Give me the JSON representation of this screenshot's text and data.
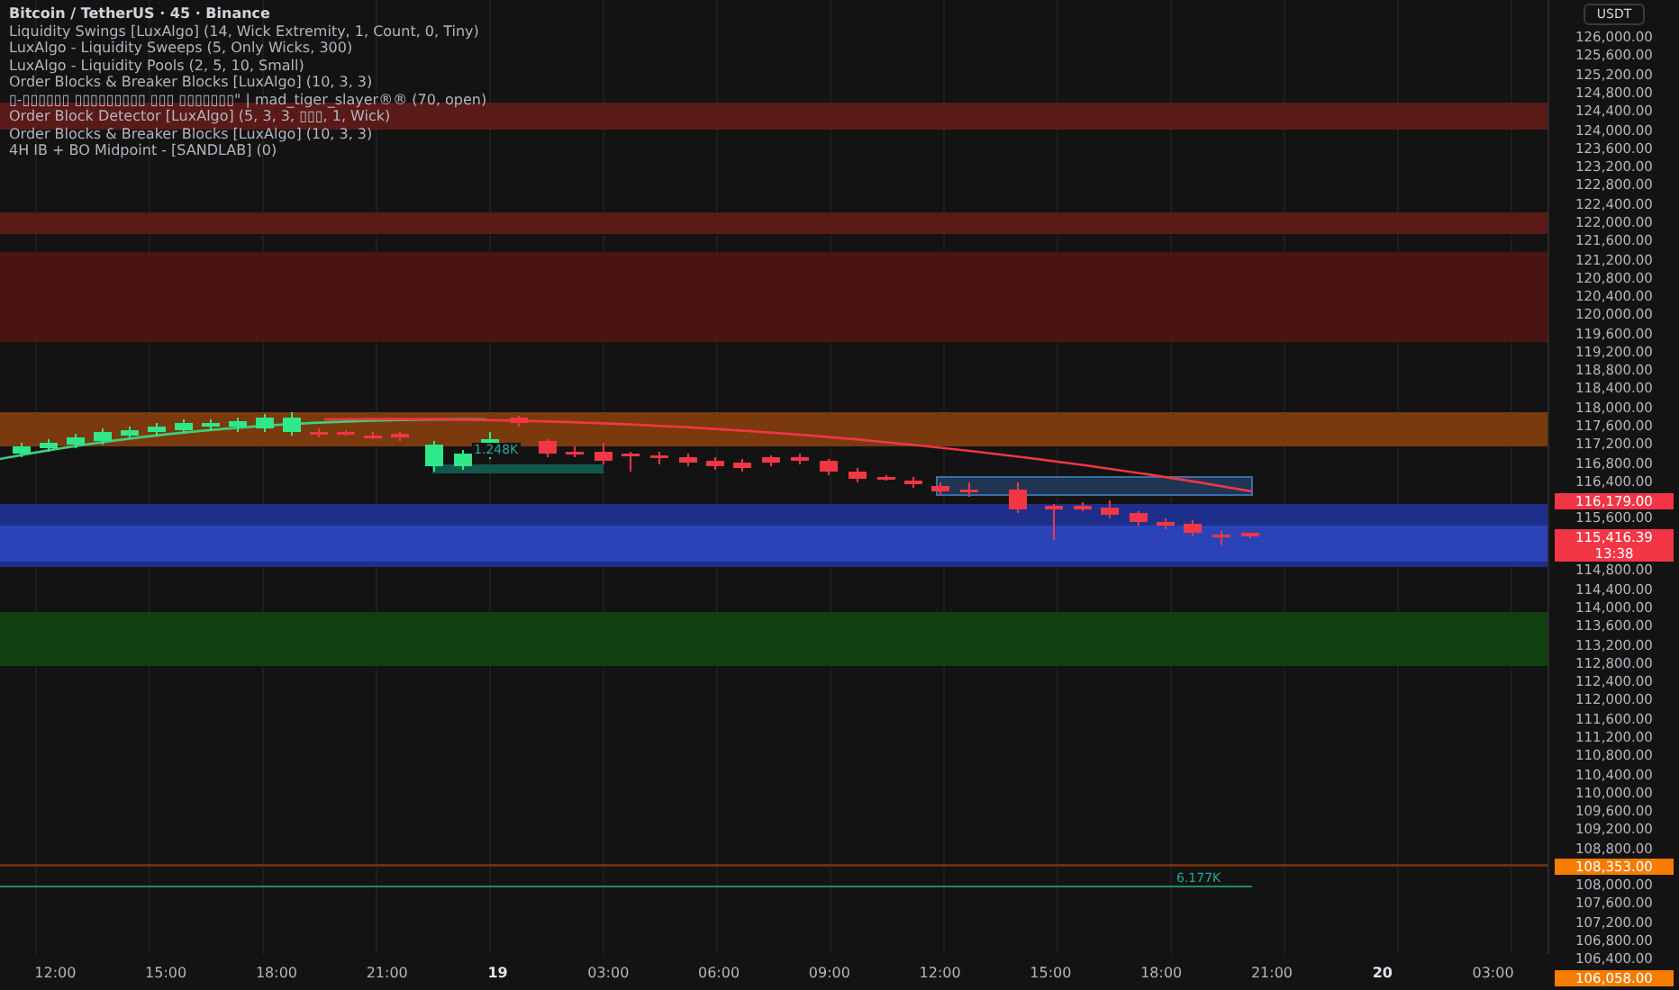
{
  "legend": {
    "title": "Bitcoin / TetherUS · 45 · Binance",
    "indicators": [
      "Liquidity Swings [LuxAlgo] (14, Wick Extremity, 1, Count, 0, Tiny)",
      "LuxAlgo - Liquidity Sweeps (5, Only Wicks, 300)",
      "LuxAlgo - Liquidity Pools (2, 5, 10, Small)",
      "Order Blocks & Breaker Blocks [LuxAlgo] (10, 3, 3)",
      "▯-▯▯▯▯▯▯ ▯▯▯▯▯▯▯▯▯ ▯▯▯ ▯▯▯▯▯▯▯\" | mad_tiger_slayer®® (70, open)",
      "Order Block Detector [LuxAlgo] (5, 3, 3, ▯▯▯, 1, Wick)",
      "Order Blocks & Breaker Blocks [LuxAlgo] (10, 3, 3)",
      "4H IB + BO Midpoint - [SANDLAB] (0)"
    ]
  },
  "chart_labels": [
    "1.248K",
    "6.177K"
  ],
  "price_axis": {
    "currency": "USDT",
    "labels": [
      {
        "kind": "tick",
        "text": "126,000.00"
      },
      {
        "kind": "tick",
        "text": "125,600.00"
      },
      {
        "kind": "tick",
        "text": "125,200.00"
      },
      {
        "kind": "tick",
        "text": "124,800.00"
      },
      {
        "kind": "tick",
        "text": "124,400.00"
      },
      {
        "kind": "tick",
        "text": "124,000.00"
      },
      {
        "kind": "tick",
        "text": "123,600.00"
      },
      {
        "kind": "tick",
        "text": "123,200.00"
      },
      {
        "kind": "tick",
        "text": "122,800.00"
      },
      {
        "kind": "tick",
        "text": "122,400.00"
      },
      {
        "kind": "tick",
        "text": "122,000.00"
      },
      {
        "kind": "tick",
        "text": "121,600.00"
      },
      {
        "kind": "tick",
        "text": "121,200.00"
      },
      {
        "kind": "tick",
        "text": "120,800.00"
      },
      {
        "kind": "tick",
        "text": "120,400.00"
      },
      {
        "kind": "tick",
        "text": "120,000.00"
      },
      {
        "kind": "tick",
        "text": "119,600.00"
      },
      {
        "kind": "tick",
        "text": "119,200.00"
      },
      {
        "kind": "tick",
        "text": "118,800.00"
      },
      {
        "kind": "tick",
        "text": "118,400.00"
      },
      {
        "kind": "tick",
        "text": "118,000.00"
      },
      {
        "kind": "tick",
        "text": "117,600.00"
      },
      {
        "kind": "tick",
        "text": "117,200.00"
      },
      {
        "kind": "tick",
        "text": "116,800.00"
      },
      {
        "kind": "tick",
        "text": "116,400.00"
      },
      {
        "kind": "tag",
        "text": "116,179.00",
        "color": "#f23645"
      },
      {
        "kind": "tick",
        "text": "115,600.00"
      },
      {
        "kind": "tag",
        "text": "115,416.39",
        "sub": "13:38",
        "color": "#f23645"
      },
      {
        "kind": "tick",
        "text": "114,800.00"
      },
      {
        "kind": "tick",
        "text": "114,400.00"
      },
      {
        "kind": "tick",
        "text": "114,000.00"
      },
      {
        "kind": "tick",
        "text": "113,600.00"
      },
      {
        "kind": "tick",
        "text": "113,200.00"
      },
      {
        "kind": "tick",
        "text": "112,800.00"
      },
      {
        "kind": "tick",
        "text": "112,400.00"
      },
      {
        "kind": "tick",
        "text": "112,000.00"
      },
      {
        "kind": "tick",
        "text": "111,600.00"
      },
      {
        "kind": "tick",
        "text": "111,200.00"
      },
      {
        "kind": "tick",
        "text": "110,800.00"
      },
      {
        "kind": "tick",
        "text": "110,400.00"
      },
      {
        "kind": "tick",
        "text": "110,000.00"
      },
      {
        "kind": "tick",
        "text": "109,600.00"
      },
      {
        "kind": "tick",
        "text": "109,200.00"
      },
      {
        "kind": "tick",
        "text": "108,800.00"
      },
      {
        "kind": "tag",
        "text": "108,353.00",
        "color": "#f57c00"
      },
      {
        "kind": "tick",
        "text": "108,000.00"
      },
      {
        "kind": "tick",
        "text": "107,600.00"
      },
      {
        "kind": "tick",
        "text": "107,200.00"
      },
      {
        "kind": "tick",
        "text": "106,800.00"
      },
      {
        "kind": "tick",
        "text": "106,400.00"
      },
      {
        "kind": "tag",
        "text": "106,058.00",
        "color": "#f57c00"
      }
    ]
  },
  "time_axis": [
    {
      "kind": "time",
      "text": "12:00"
    },
    {
      "kind": "time",
      "text": "15:00"
    },
    {
      "kind": "time",
      "text": "18:00"
    },
    {
      "kind": "time",
      "text": "21:00"
    },
    {
      "kind": "day",
      "text": "19"
    },
    {
      "kind": "time",
      "text": "03:00"
    },
    {
      "kind": "time",
      "text": "06:00"
    },
    {
      "kind": "time",
      "text": "09:00"
    },
    {
      "kind": "time",
      "text": "12:00"
    },
    {
      "kind": "time",
      "text": "15:00"
    },
    {
      "kind": "time",
      "text": "18:00"
    },
    {
      "kind": "time",
      "text": "21:00"
    },
    {
      "kind": "day",
      "text": "20"
    },
    {
      "kind": "time",
      "text": "03:00"
    }
  ]
}
